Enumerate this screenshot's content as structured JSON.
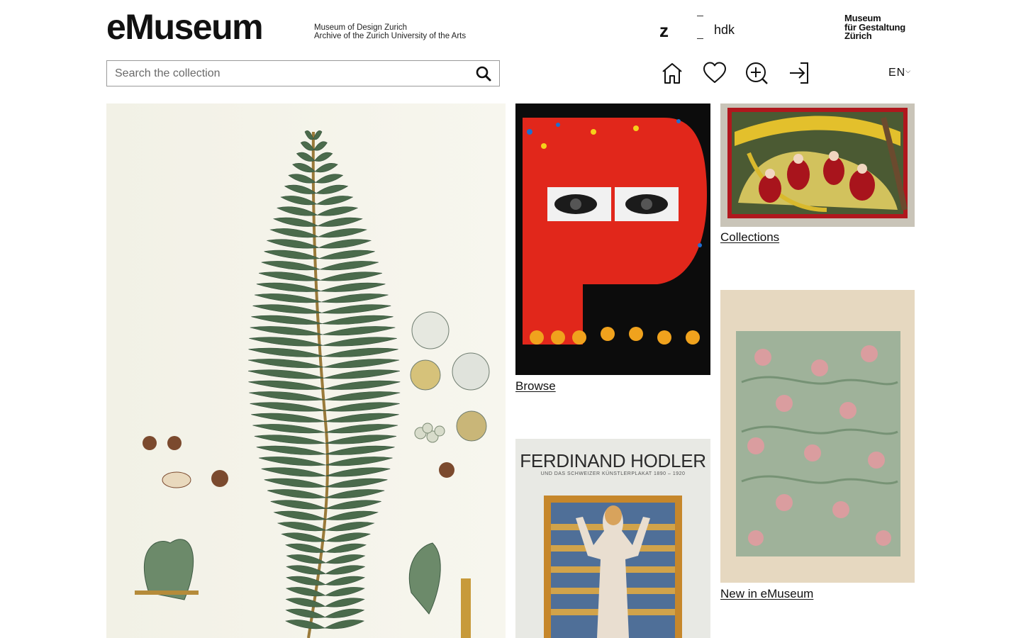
{
  "header": {
    "logo": "eMuseum",
    "subtitle_line1": "Museum of Design Zurich",
    "subtitle_line2": "Archive of the Zurich University of the Arts",
    "zhdk_z": "z",
    "zhdk_hdk": "hdk",
    "mfg_line1": "Museum",
    "mfg_line2": "für Gestaltung",
    "mfg_line3": "Zürich",
    "language": "EN"
  },
  "search": {
    "placeholder": "Search the collection"
  },
  "nav": {
    "icons": [
      "home-icon",
      "heart-icon",
      "zoom-in-icon",
      "login-icon",
      "search-icon",
      "chevron-down-icon"
    ]
  },
  "tiles": {
    "browse_label": "Browse",
    "collections_label": "Collections",
    "new_label": "New in eMuseum",
    "hodler_title": "FERDINAND HODLER",
    "hodler_subtitle": "UND DAS SCHWEIZER KÜNSTLERPLAKAT 1890 – 1920"
  }
}
